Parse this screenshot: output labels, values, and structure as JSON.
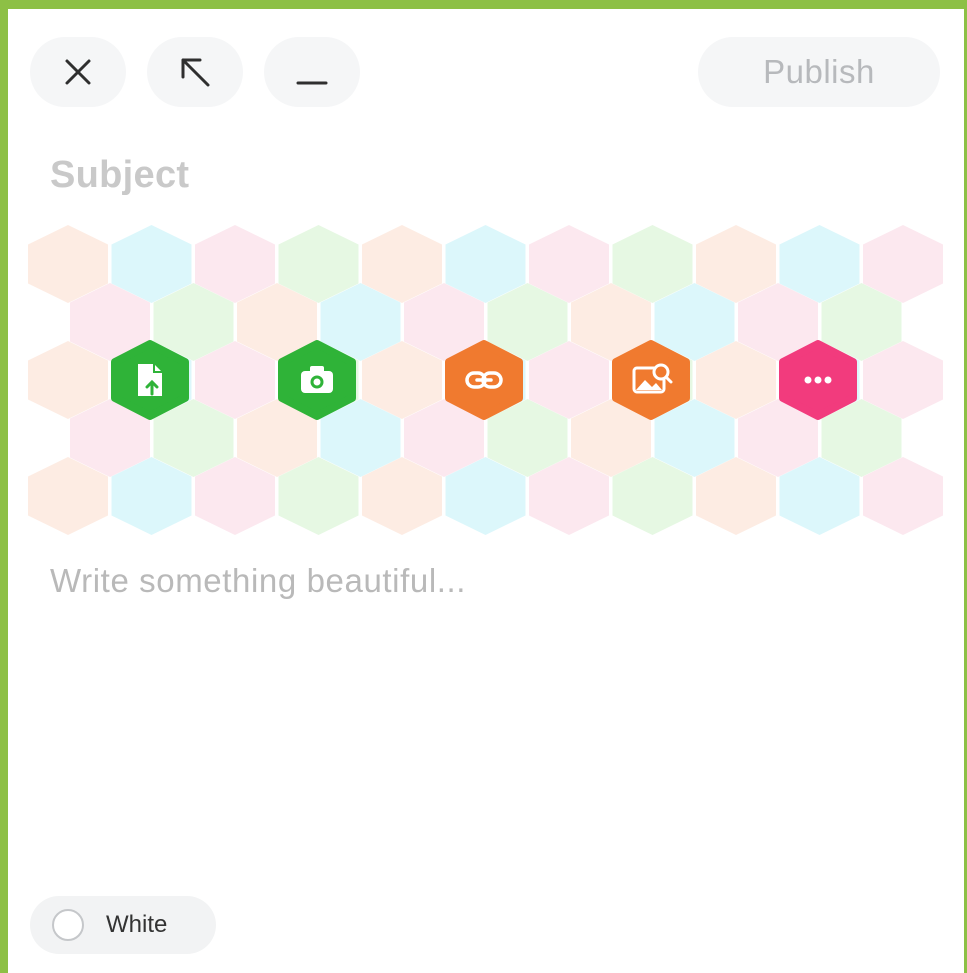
{
  "toolbar": {
    "close_icon": "close-icon",
    "expand_icon": "arrow-up-left-icon",
    "minimize_icon": "minimize-icon",
    "publish_label": "Publish"
  },
  "composer": {
    "subject_placeholder": "Subject",
    "body_placeholder": "Write something beautiful..."
  },
  "actions": [
    {
      "name": "upload-file",
      "icon": "file-upload-icon",
      "color": "#2fb338"
    },
    {
      "name": "camera",
      "icon": "camera-icon",
      "color": "#2fb338"
    },
    {
      "name": "link",
      "icon": "link-icon",
      "color": "#f07a2f"
    },
    {
      "name": "image-search",
      "icon": "image-search-icon",
      "color": "#f07a2f"
    },
    {
      "name": "more",
      "icon": "more-icon",
      "color": "#f23b7d"
    }
  ],
  "theme": {
    "label": "White"
  },
  "colors": {
    "frame_border": "#8dc045",
    "pastel_peach": "#fdece3",
    "pastel_cyan": "#dcf7fb",
    "pastel_pink": "#fce8ef",
    "pastel_green": "#e6f8e3"
  }
}
